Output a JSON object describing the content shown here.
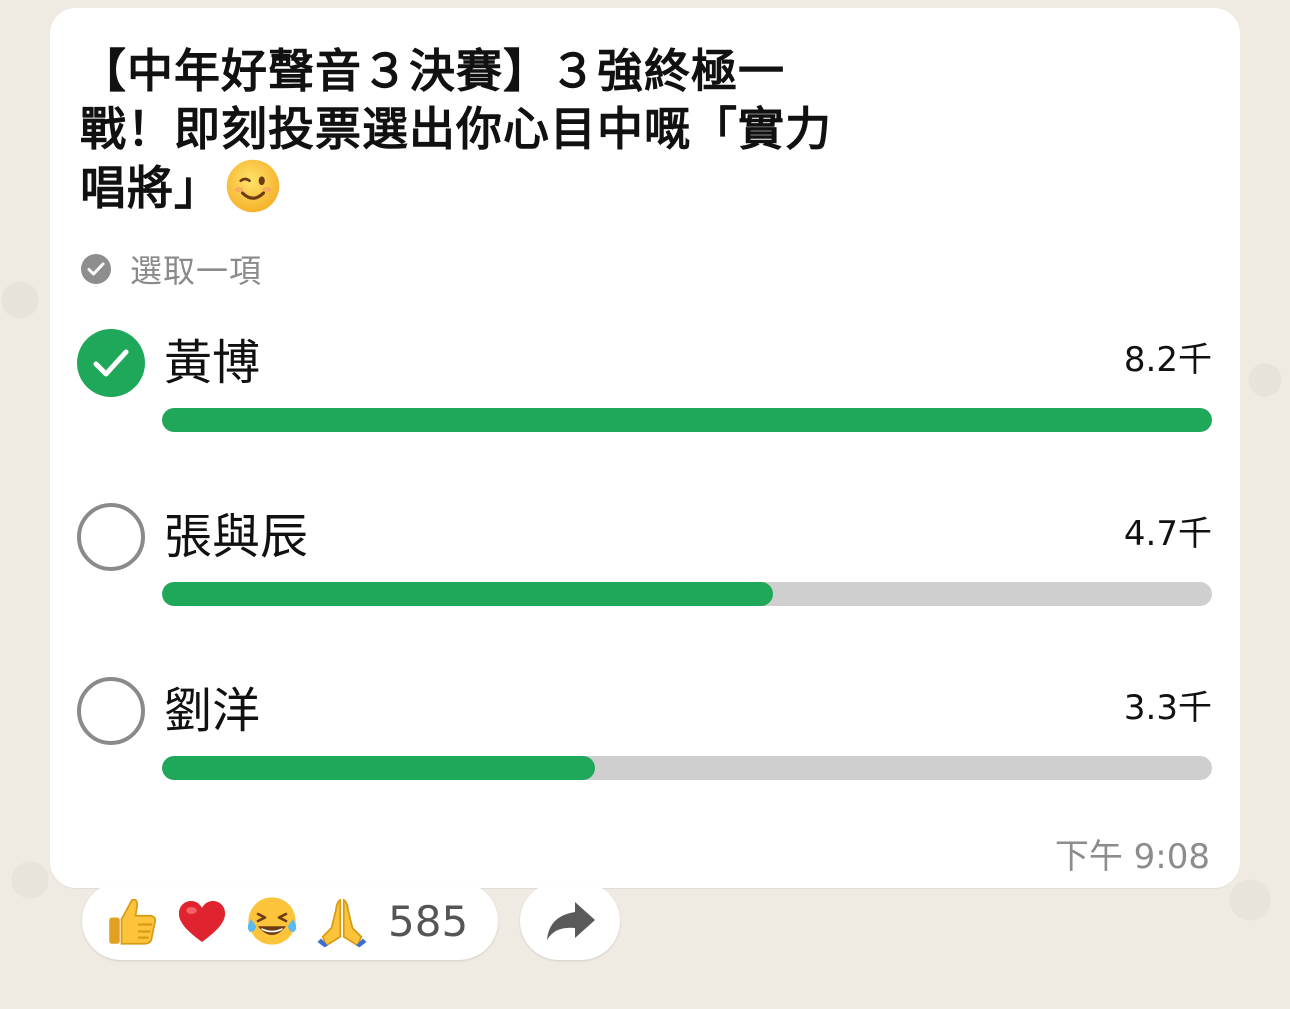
{
  "poll": {
    "question": "【中年好聲音３決賽】３強終極一戰！即刻投票選出你心目中嘅「實力唱將」",
    "select_hint": "選取一項",
    "options": [
      {
        "label": "黃博",
        "votes": "8.2千",
        "fraction": 1.0,
        "selected": true
      },
      {
        "label": "張與辰",
        "votes": "4.7千",
        "fraction": 0.582,
        "selected": false
      },
      {
        "label": "劉洋",
        "votes": "3.3千",
        "fraction": 0.412,
        "selected": false
      }
    ],
    "timestamp": "下午 9:08"
  },
  "reactions": {
    "emojis": [
      "thumbs-up-icon",
      "heart-icon",
      "laughing-tears-icon",
      "folded-hands-icon"
    ],
    "count": "585"
  },
  "colors": {
    "accent": "#1fa85a",
    "track": "#cfcfcf",
    "bubble": "#ffffff",
    "wallpaper": "#efebe3"
  }
}
